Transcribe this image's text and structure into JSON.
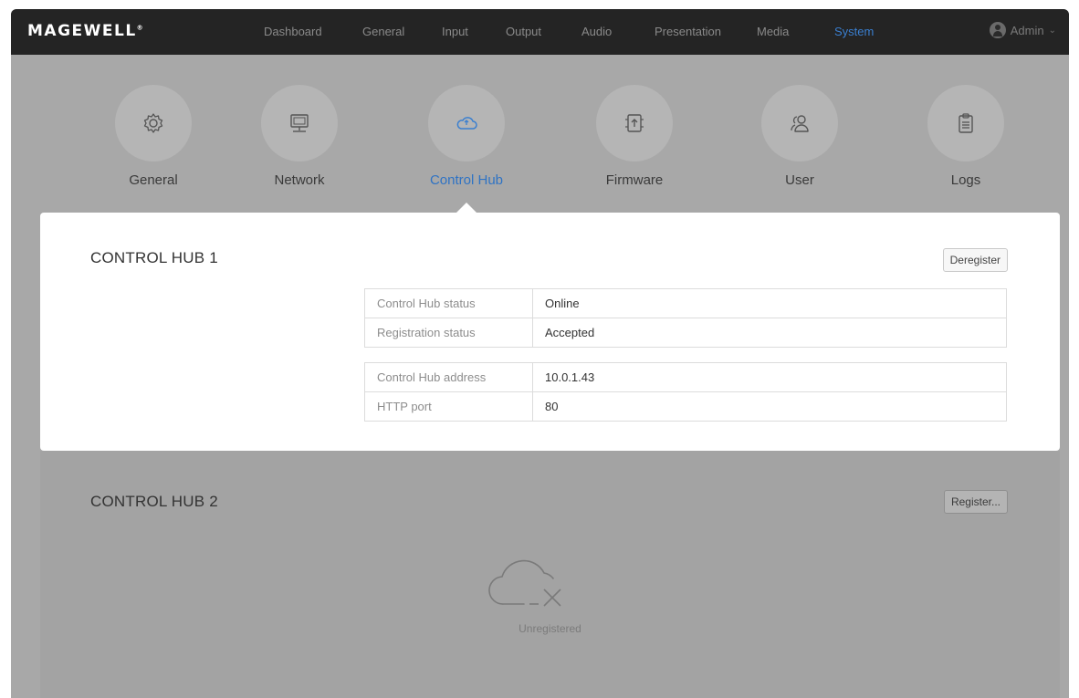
{
  "app": {
    "brand": "MAGEWELL",
    "brand_mark": "®"
  },
  "nav": {
    "items": [
      {
        "label": "Dashboard",
        "active": false
      },
      {
        "label": "General",
        "active": false
      },
      {
        "label": "Input",
        "active": false
      },
      {
        "label": "Output",
        "active": false
      },
      {
        "label": "Audio",
        "active": false
      },
      {
        "label": "Presentation",
        "active": false
      },
      {
        "label": "Media",
        "active": false
      },
      {
        "label": "System",
        "active": true
      }
    ],
    "user": "Admin"
  },
  "categories": [
    {
      "label": "General",
      "icon": "gear-icon",
      "active": false
    },
    {
      "label": "Network",
      "icon": "monitor-network-icon",
      "active": false
    },
    {
      "label": "Control Hub",
      "icon": "cloud-icon",
      "active": true
    },
    {
      "label": "Firmware",
      "icon": "firmware-upload-icon",
      "active": false
    },
    {
      "label": "User",
      "icon": "users-icon",
      "active": false
    },
    {
      "label": "Logs",
      "icon": "clipboard-icon",
      "active": false
    }
  ],
  "hub1": {
    "title": "CONTROL HUB 1",
    "action": "Deregister",
    "status_rows": [
      {
        "key": "Control Hub status",
        "value": "Online"
      },
      {
        "key": "Registration status",
        "value": "Accepted"
      }
    ],
    "address_rows": [
      {
        "key": "Control Hub address",
        "value": "10.0.1.43"
      },
      {
        "key": "HTTP port",
        "value": "80"
      }
    ]
  },
  "hub2": {
    "title": "CONTROL HUB 2",
    "action": "Register...",
    "state": "Unregistered",
    "state_icon": "cloud-off-icon"
  },
  "colors": {
    "accent": "#3a7fd0",
    "navbar": "#242424"
  }
}
